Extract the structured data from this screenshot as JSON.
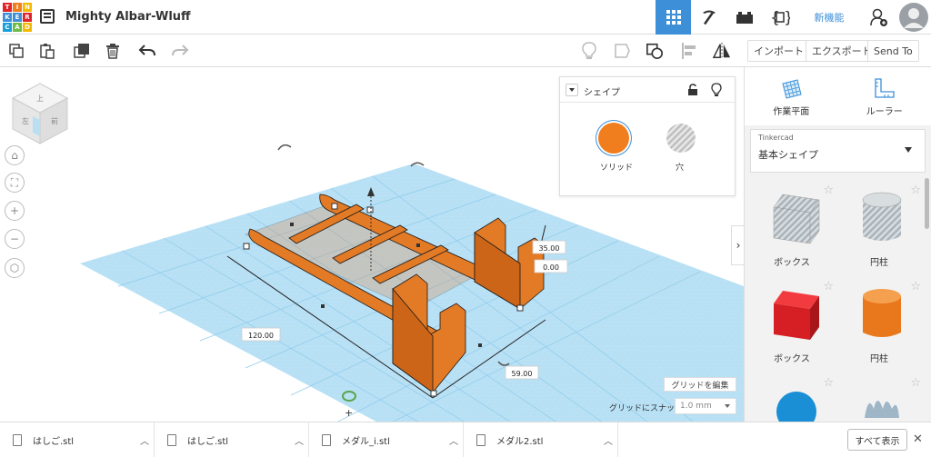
{
  "app": {
    "logo_letters": [
      "TIN",
      "KER",
      "CAD"
    ],
    "title": "Mighty Albar-Wluff"
  },
  "header": {
    "new_features": "新機能"
  },
  "toolbar": {
    "import": "インポート",
    "export": "エクスポート",
    "send_to": "Send To"
  },
  "inspector": {
    "title": "シェイプ",
    "solid_label": "ソリッド",
    "hole_label": "穴",
    "solid_color": "#f07e1e"
  },
  "dimensions": {
    "length": "120.00",
    "width": "59.00",
    "height": "35.00",
    "elevation": "0.00"
  },
  "view": {
    "cube_top": "上",
    "cube_front": "前",
    "cube_left": "左",
    "edit_grid": "グリッドを編集",
    "snap_label": "グリッドにスナップ",
    "snap_value": "1.0 mm"
  },
  "rpanel": {
    "workplane": "作業平面",
    "ruler": "ルーラー",
    "library_sub": "Tinkercad",
    "library": "基本シェイプ",
    "shapes": [
      {
        "label": "ボックス",
        "kind": "box-hole"
      },
      {
        "label": "円柱",
        "kind": "cyl-hole"
      },
      {
        "label": "ボックス",
        "kind": "box-red"
      },
      {
        "label": "円柱",
        "kind": "cyl-orange"
      }
    ]
  },
  "downloads": {
    "items": [
      "はしご.stl",
      "はしご.stl",
      "メダル_i.stl",
      "メダル2.stl"
    ],
    "show_all": "すべて表示"
  },
  "colors": {
    "accent": "#3d8fd8",
    "orange": "#f07e1e",
    "grid": "#a9d8f0",
    "red": "#e0242a"
  }
}
